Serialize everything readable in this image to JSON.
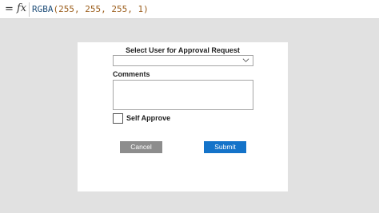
{
  "formula_bar": {
    "equals_symbol": "=",
    "fx_symbol": "fx",
    "function_name": "RGBA",
    "formula_args": "(255, 255, 255, 1)"
  },
  "form": {
    "title": "Select User for Approval Request",
    "user_dropdown_value": "",
    "comments_label": "Comments",
    "comments_value": "",
    "self_approve_label": "Self Approve",
    "self_approve_checked": false,
    "cancel_label": "Cancel",
    "submit_label": "Submit"
  },
  "colors": {
    "canvas_background": "#e1e1e1",
    "card_background": "#ffffff",
    "cancel_button": "#8d8d8d",
    "submit_button": "#1473c9"
  },
  "icons": {
    "dropdown": "chevron-down-icon",
    "formula": "fx-icon"
  }
}
